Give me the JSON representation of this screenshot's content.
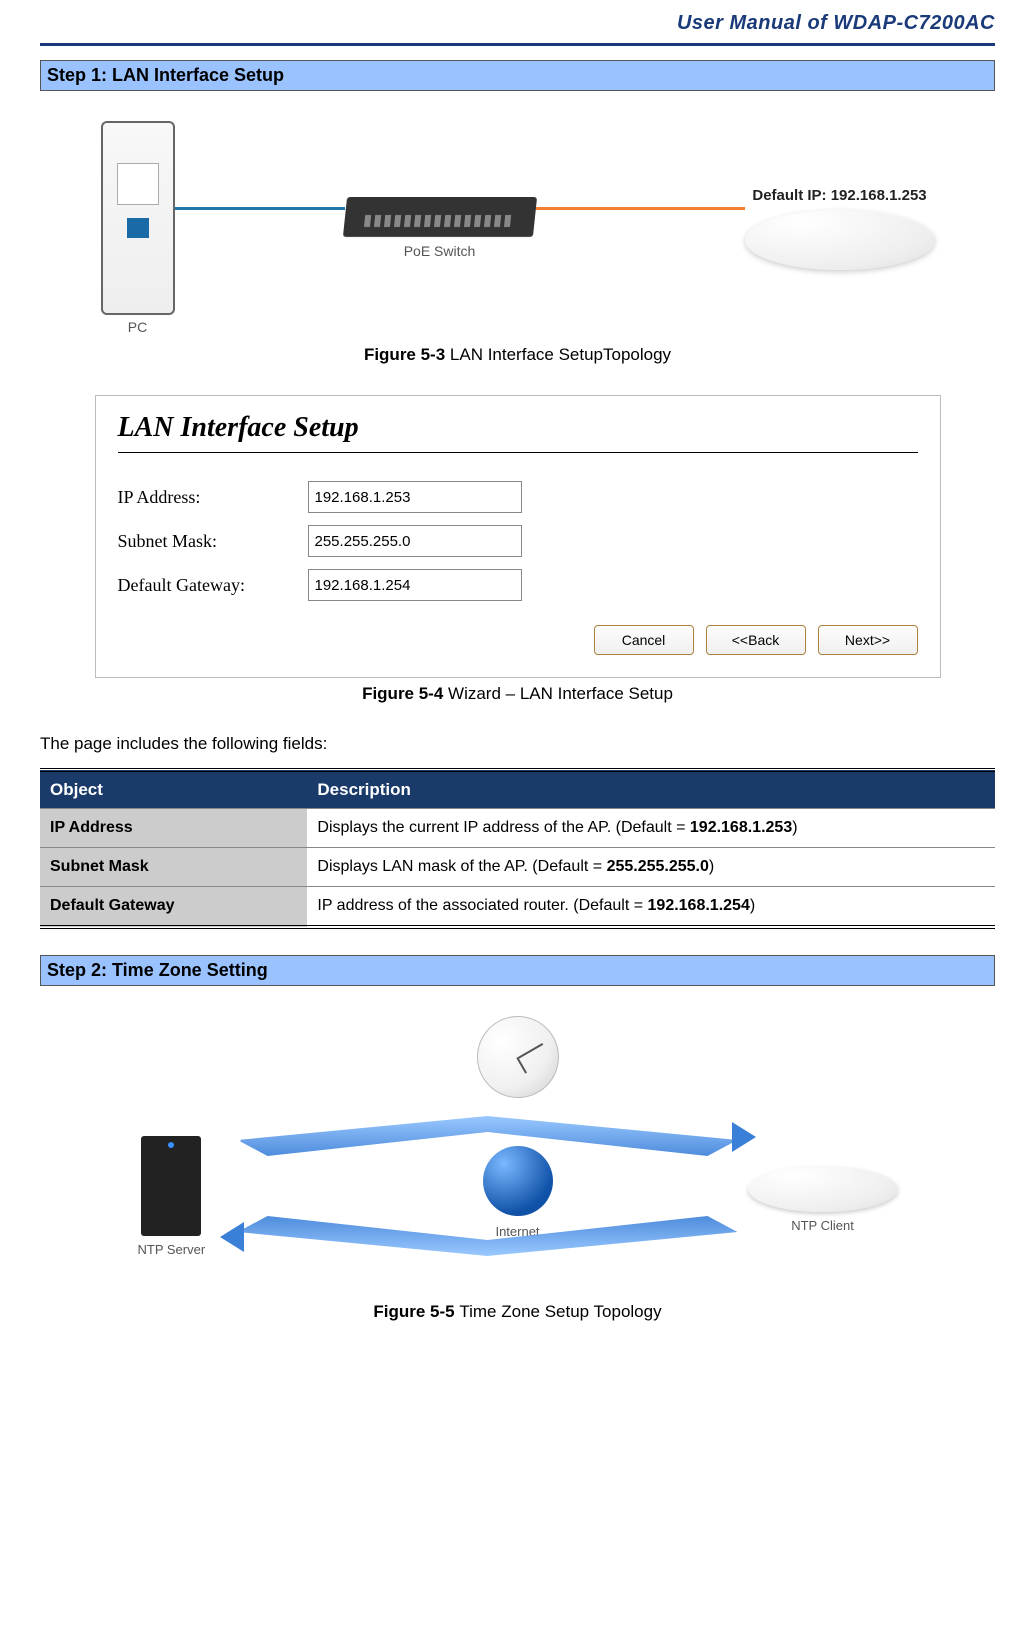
{
  "header": {
    "title": "User Manual of WDAP-C7200AC"
  },
  "step1": {
    "title": "Step 1: LAN Interface Setup"
  },
  "step2": {
    "title": "Step 2: Time Zone Setting"
  },
  "fig53": {
    "bold": "Figure 5-3 ",
    "rest": "LAN Interface SetupTopology",
    "pc_label": "PC",
    "switch_label": "PoE Switch",
    "ap_ip_label": "Default IP: 192.168.1.253"
  },
  "fig54": {
    "bold": "Figure 5-4 ",
    "rest": "Wizard – LAN Interface Setup",
    "panel_title": "LAN Interface Setup",
    "rows": {
      "ip": {
        "label": "IP Address:",
        "value": "192.168.1.253"
      },
      "mask": {
        "label": "Subnet Mask:",
        "value": "255.255.255.0"
      },
      "gw": {
        "label": "Default Gateway:",
        "value": "192.168.1.254"
      }
    },
    "buttons": {
      "cancel": "Cancel",
      "back": "<<Back",
      "next": "Next>>"
    }
  },
  "intro": "The page includes the following fields:",
  "table": {
    "head": {
      "object": "Object",
      "description": "Description"
    },
    "rows": [
      {
        "object": "IP Address",
        "desc_pre": "Displays the current IP address of the AP. (Default = ",
        "desc_bold": "192.168.1.253",
        "desc_post": ")"
      },
      {
        "object": "Subnet Mask",
        "desc_pre": "Displays LAN mask of the AP. (Default = ",
        "desc_bold": "255.255.255.0",
        "desc_post": ")"
      },
      {
        "object": "Default Gateway",
        "desc_pre": "IP address of the associated router. (Default = ",
        "desc_bold": "192.168.1.254",
        "desc_post": ")"
      }
    ]
  },
  "fig55": {
    "bold": "Figure 5-5 ",
    "rest": "Time Zone Setup Topology",
    "ntp_server": "NTP Server",
    "internet": "Internet",
    "ntp_client": "NTP Client"
  }
}
